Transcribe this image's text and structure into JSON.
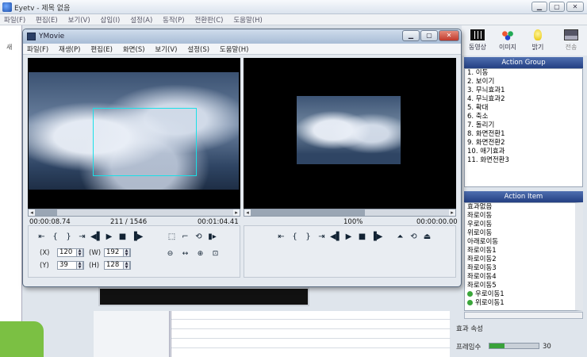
{
  "app": {
    "title": "Eyetv - 제목 없음",
    "menu": [
      "파일(F)",
      "편집(E)",
      "보기(V)",
      "삽입(I)",
      "설정(A)",
      "동작(P)",
      "전환판(C)",
      "도움말(H)"
    ],
    "left_tab": "새"
  },
  "toolbar": {
    "buttons": [
      {
        "label": "동영상",
        "icon": "film-icon"
      },
      {
        "label": "이미지",
        "icon": "color-dots-icon"
      },
      {
        "label": "밝기",
        "icon": "lightbulb-icon"
      },
      {
        "label": "전송",
        "icon": "transfer-icon"
      }
    ]
  },
  "action_group": {
    "header": "Action Group",
    "items": [
      "1. 이동",
      "2. 보이기",
      "3. 무늬효과1",
      "4. 무늬효과2",
      "5. 확대",
      "6. 축소",
      "7. 돌리기",
      "8. 화면전환1",
      "9. 화면전환2",
      "10. 애기효과",
      "11. 화면전환3"
    ]
  },
  "action_item": {
    "header": "Action Item",
    "items": [
      {
        "label": "효과없음",
        "dot": false
      },
      {
        "label": "좌로이동",
        "dot": false
      },
      {
        "label": "우로이동",
        "dot": false
      },
      {
        "label": "위로이동",
        "dot": false
      },
      {
        "label": "아래로이동",
        "dot": false
      },
      {
        "label": "좌로이동1",
        "dot": false
      },
      {
        "label": "좌로이동2",
        "dot": false
      },
      {
        "label": "좌로이동3",
        "dot": false
      },
      {
        "label": "좌로이동4",
        "dot": false
      },
      {
        "label": "좌로이동5",
        "dot": false
      },
      {
        "label": "우로이동1",
        "dot": true
      },
      {
        "label": "위로이동1",
        "dot": true
      }
    ]
  },
  "properties": {
    "section_label": "효과 속성",
    "frame_label": "프레임수",
    "frame_value": "30",
    "frame_level": 0.3
  },
  "ymovie": {
    "title": "YMovie",
    "menu": [
      "파일(F)",
      "재생(P)",
      "편집(E)",
      "화면(S)",
      "보기(V)",
      "설정(S)",
      "도움말(H)"
    ],
    "left_time_start": "00:00:08.74",
    "left_frame": "211 / 1546",
    "left_time_end": "00:01:04.41",
    "left_progress": 0.136,
    "right_zoom": "100%",
    "right_time": "00:00:00.00",
    "right_progress": 0.57,
    "fields": {
      "x_label": "(X)",
      "x_value": "120",
      "y_label": "(Y)",
      "y_value": "39",
      "w_label": "(W)",
      "w_value": "192",
      "h_label": "(H)",
      "h_value": "128"
    }
  }
}
